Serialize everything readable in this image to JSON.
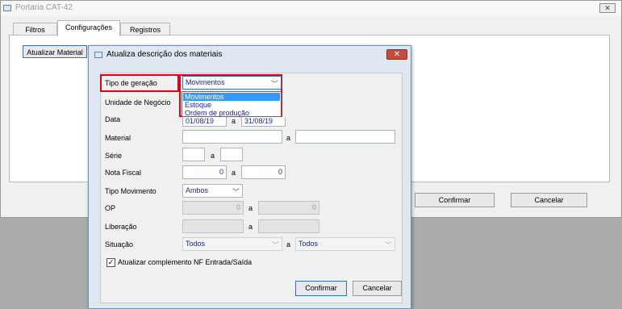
{
  "parent": {
    "title": "Portaria CAT-42",
    "close_glyph": "✕",
    "tabs": [
      "Filtros",
      "Configurações",
      "Registros"
    ],
    "active_tab": "Configurações",
    "update_button": "Atualizar Material",
    "confirm_button": "Confirmar",
    "cancel_button": "Cancelar"
  },
  "dialog": {
    "title": "Atualiza descrição dos materiais",
    "close_glyph": "✕",
    "fields": {
      "tipo_geracao": {
        "label": "Tipo de geração",
        "value": "Movimentos",
        "options": [
          "Movimentos",
          "Estoque",
          "Ordem de produção"
        ]
      },
      "unidade_negocio": {
        "label": "Unidade de Negócio"
      },
      "data": {
        "label": "Data",
        "from": "01/08/19",
        "sep": "a",
        "to": "31/08/19"
      },
      "material": {
        "label": "Material",
        "sep": "a"
      },
      "serie": {
        "label": "Série",
        "sep": "a"
      },
      "nota_fiscal": {
        "label": "Nota Fiscal",
        "from": "0",
        "sep": "a",
        "to": "0"
      },
      "tipo_movimento": {
        "label": "Tipo Movimento",
        "value": "Ambos"
      },
      "op": {
        "label": "OP",
        "from": "0",
        "sep": "a",
        "to": "0"
      },
      "liberacao": {
        "label": "Liberação",
        "sep": "a"
      },
      "situacao": {
        "label": "Situação",
        "from": "Todos",
        "sep": "a",
        "to": "Todos"
      }
    },
    "checkbox": {
      "label": "Atualizar complemento NF Entrada/Saída",
      "checked": true
    },
    "confirm_button": "Confirmar",
    "cancel_button": "Cancelar"
  },
  "colors": {
    "highlight": "#3399ff",
    "annotation_red": "#e3001b",
    "close_red": "#c84a3a"
  }
}
